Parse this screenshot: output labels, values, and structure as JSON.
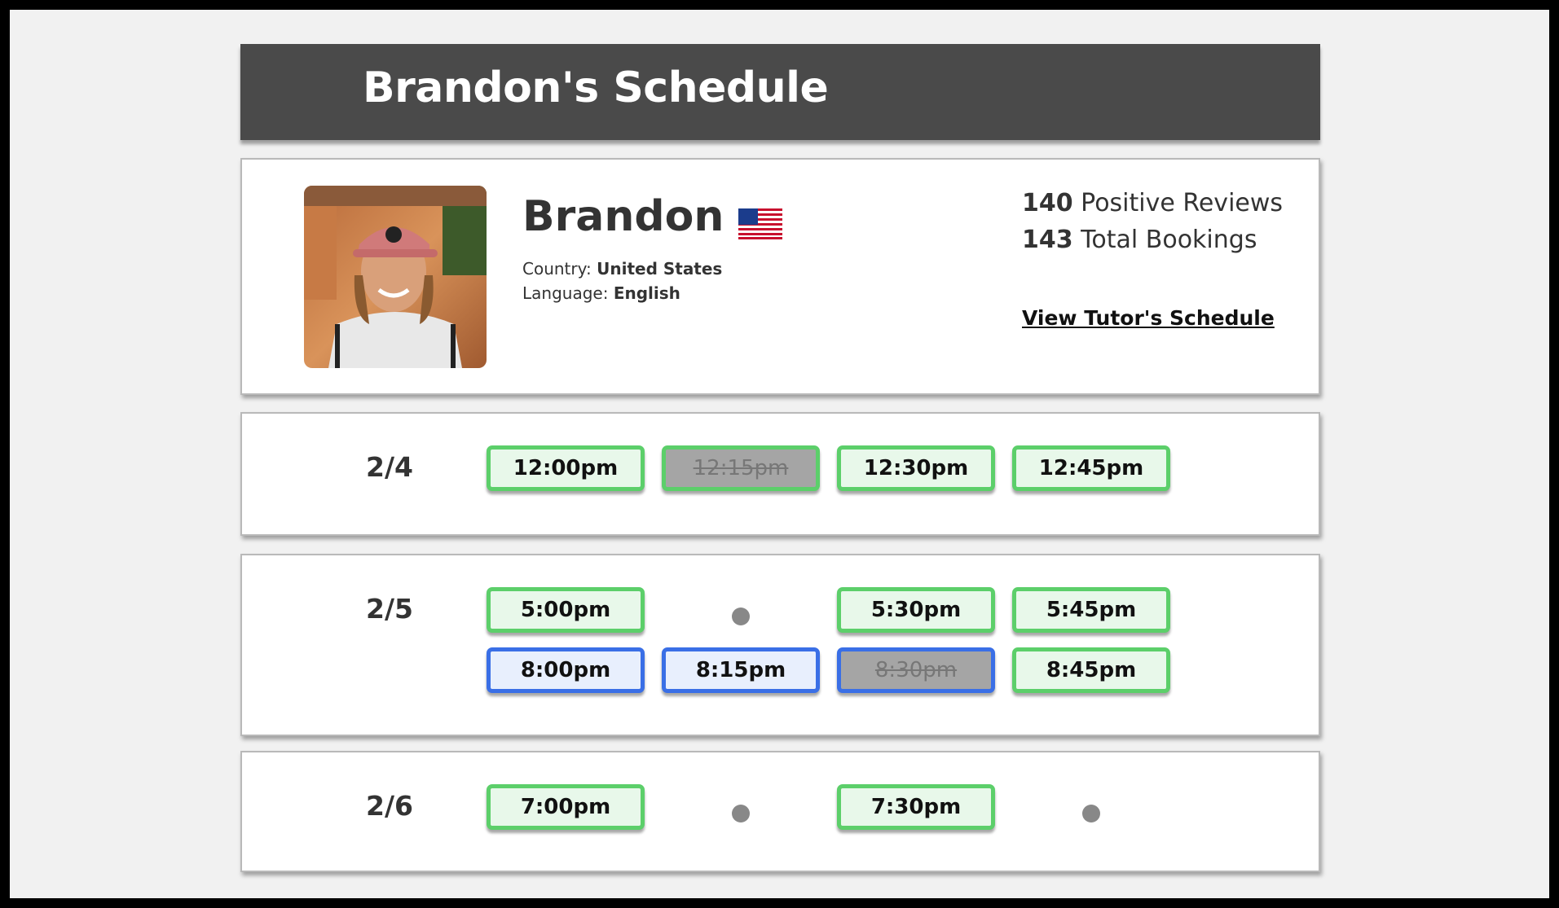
{
  "page": {
    "title": "Brandon's Schedule"
  },
  "tutor": {
    "name": "Brandon",
    "country_label": "Country:",
    "country": "United States",
    "language_label": "Language:",
    "language": "English",
    "positive_reviews_count": "140",
    "positive_reviews_label": "Positive Reviews",
    "total_bookings_count": "143",
    "total_bookings_label": "Total Bookings",
    "schedule_link": "View Tutor's Schedule"
  },
  "days": [
    {
      "date": "2/4",
      "slots": [
        {
          "time": "12:00pm",
          "color": "green",
          "booked": false
        },
        {
          "time": "12:15pm",
          "color": "green",
          "booked": true
        },
        {
          "time": "12:30pm",
          "color": "green",
          "booked": false
        },
        {
          "time": "12:45pm",
          "color": "green",
          "booked": false
        }
      ]
    },
    {
      "date": "2/5",
      "slots": [
        {
          "time": "5:00pm",
          "color": "green",
          "booked": false
        },
        {
          "time": "",
          "empty": true
        },
        {
          "time": "5:30pm",
          "color": "green",
          "booked": false
        },
        {
          "time": "5:45pm",
          "color": "green",
          "booked": false
        },
        {
          "time": "8:00pm",
          "color": "blue",
          "booked": false
        },
        {
          "time": "8:15pm",
          "color": "blue",
          "booked": false
        },
        {
          "time": "8:30pm",
          "color": "blue",
          "booked": true
        },
        {
          "time": "8:45pm",
          "color": "green",
          "booked": false
        }
      ]
    },
    {
      "date": "2/6",
      "slots": [
        {
          "time": "7:00pm",
          "color": "green",
          "booked": false
        },
        {
          "time": "",
          "empty": true
        },
        {
          "time": "7:30pm",
          "color": "green",
          "booked": false
        },
        {
          "time": "",
          "empty": true
        }
      ]
    }
  ],
  "colors": {
    "header_bg": "#4a4a4a",
    "available_border": "#5ccf6a",
    "available_bg": "#e8f8ea",
    "blue_border": "#3a6fe6",
    "blue_bg": "#e8effd",
    "booked_bg": "#a5a5a5",
    "empty_dot": "#888888"
  },
  "icons": {
    "flag": "us-flag-icon",
    "empty_slot": "dot-icon"
  }
}
